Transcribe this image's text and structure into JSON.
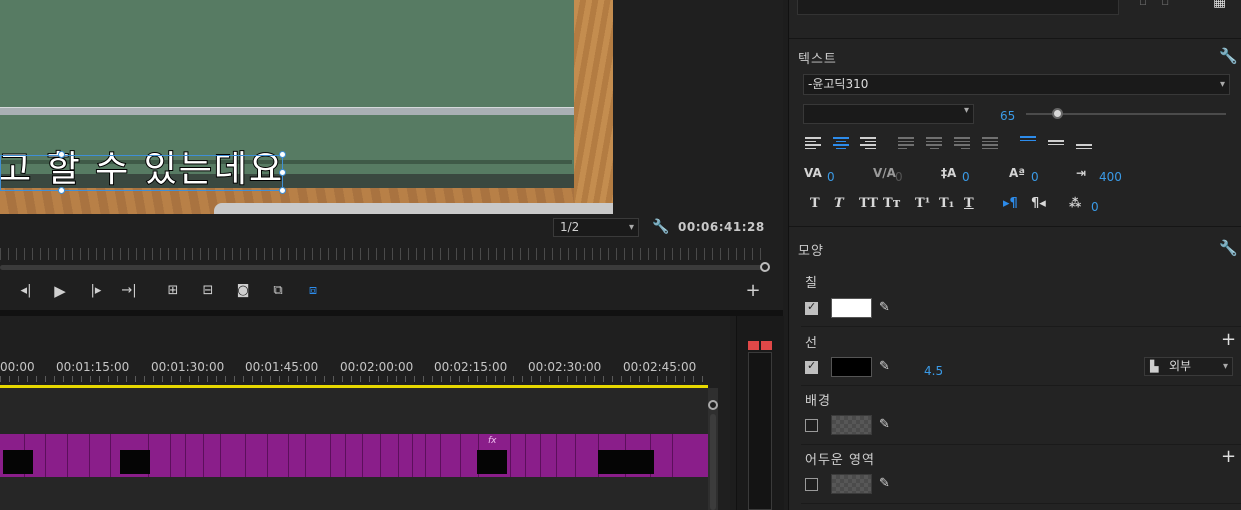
{
  "monitor": {
    "subtitle": "고 할 수 있는데요",
    "resolution": "1/2",
    "timecode": "00:06:41:28"
  },
  "timeline": {
    "timecodes": [
      "00:00",
      "00:01:15:00",
      "00:01:30:00",
      "00:01:45:00",
      "00:02:00:00",
      "00:02:15:00",
      "00:02:30:00",
      "00:02:45:00"
    ],
    "fx_badge": "fx"
  },
  "panel": {
    "text_section": {
      "title": "텍스트",
      "font_family": "-윤고딕310",
      "font_style": "",
      "font_size": "65",
      "font_size_fraction": 0.13,
      "kerning": "0",
      "tracking": "0",
      "leading": "0",
      "baseline_shift": "0",
      "tab_width": "400",
      "tsume": "0"
    },
    "appearance": {
      "title": "모양",
      "fill_label": "칠",
      "fill_checked": true,
      "fill_color": "#ffffff",
      "stroke_label": "선",
      "stroke_checked": true,
      "stroke_color": "#000000",
      "stroke_width": "4.5",
      "stroke_position": "외부",
      "background_label": "배경",
      "background_checked": false,
      "shadow_label": "어두운 영역",
      "shadow_checked": false
    }
  },
  "colors": {
    "accent": "#2d8ceb",
    "clip": "#8a1e8a",
    "workarea": "#e6d800",
    "meter_peak": "#e04848"
  }
}
